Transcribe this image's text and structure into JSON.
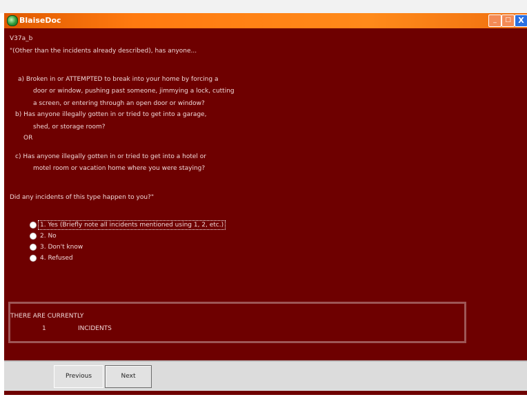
{
  "window": {
    "title": "BlaiseDoc",
    "buttons": {
      "minimize": "_",
      "maximize": "□",
      "close": "X"
    }
  },
  "question": {
    "field_id": "V37a_b",
    "lines": [
      "\"(Other than the incidents already described), has anyone...",
      "a) Broken in or ATTEMPTED to break into your home by forcing a",
      "door or window, pushing past someone, jimmying a lock, cutting",
      "a screen, or entering through an open door or window?",
      "b) Has anyone illegally gotten in or tried to get into a garage,",
      "shed, or storage room?",
      "OR",
      "c) Has anyone illegally gotten in or tried to get into a hotel or",
      "motel room or vacation home where you were staying?",
      "Did any incidents of this type happen to you?\""
    ]
  },
  "options": [
    {
      "label": "1. Yes (Briefly note all incidents mentioned using 1, 2, etc.)",
      "selected": true
    },
    {
      "label": "2. No",
      "selected": false
    },
    {
      "label": "3. Don't know",
      "selected": false
    },
    {
      "label": "4. Refused",
      "selected": false
    }
  ],
  "incidents": {
    "heading": "THERE ARE CURRENTLY",
    "count": "1",
    "label": "INCIDENTS"
  },
  "nav": {
    "previous": "Previous",
    "next": "Next"
  }
}
